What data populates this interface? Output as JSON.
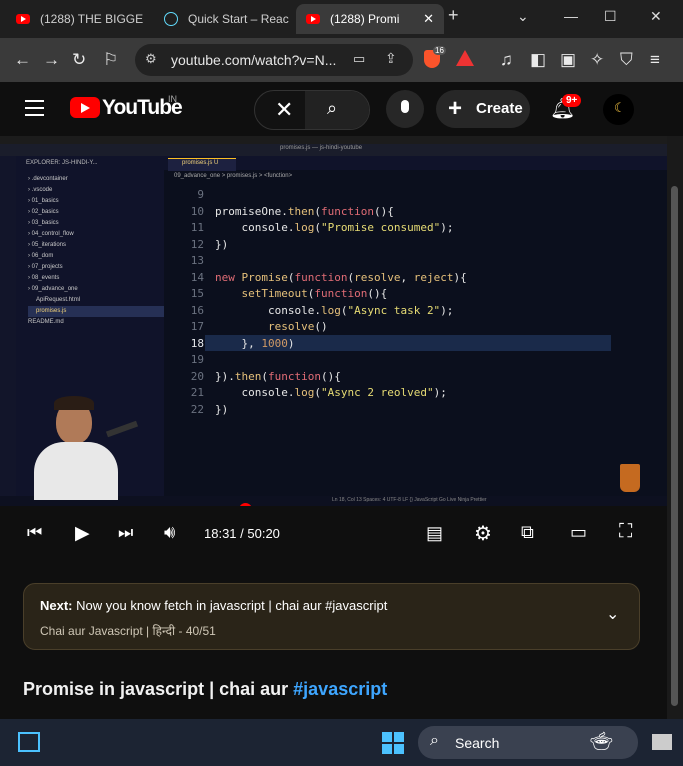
{
  "browser": {
    "tabs": [
      {
        "title": "(1288) THE BIGGE",
        "icon": "youtube-icon"
      },
      {
        "title": "Quick Start – Reac",
        "icon": "react-icon"
      },
      {
        "title": "(1288) Promi",
        "icon": "youtube-icon"
      }
    ],
    "url": "youtube.com/watch?v=N...",
    "brave_badge": "16"
  },
  "youtube": {
    "logo_text": "YouTube",
    "country": "IN",
    "create_label": "Create",
    "notification_count": "9+"
  },
  "video": {
    "editor_title": "promises.js — js-hindi-youtube",
    "explorer_title": "EXPLORER: JS-HINDI-Y...",
    "tab_name": "promises.js U",
    "breadcrumb": "09_advance_one > promises.js > <function>",
    "files": [
      ".devcontainer",
      ".vscode",
      "01_basics",
      "02_basics",
      "03_basics",
      "04_control_flow",
      "05_iterations",
      "06_dom",
      "07_projects",
      "08_events",
      "09_advance_one",
      "ApiRequest.html",
      "promises.js",
      "README.md"
    ],
    "line_numbers": [
      "9",
      "10",
      "11",
      "12",
      "13",
      "14",
      "15",
      "16",
      "17",
      "18",
      "19",
      "20",
      "21",
      "22"
    ],
    "time": "18:31 / 50:20",
    "progress": 0.364,
    "status_bar": "Ln 18, Col 13   Spaces: 4   UTF-8   LF   {} JavaScript   Go Live   Ninja   Prettier"
  },
  "next": {
    "prefix": "Next:",
    "title": "Now you know fetch in javascript | chai aur #javascript",
    "sub": "Chai aur Javascript | हिन्दी - 40/51"
  },
  "video_title": {
    "text": "Promise in javascript | chai aur ",
    "hashtag": "#javascript"
  },
  "taskbar": {
    "search_label": "Search"
  },
  "colors": {
    "accent": "#ff0000",
    "hashtag": "#3ea6ff"
  }
}
